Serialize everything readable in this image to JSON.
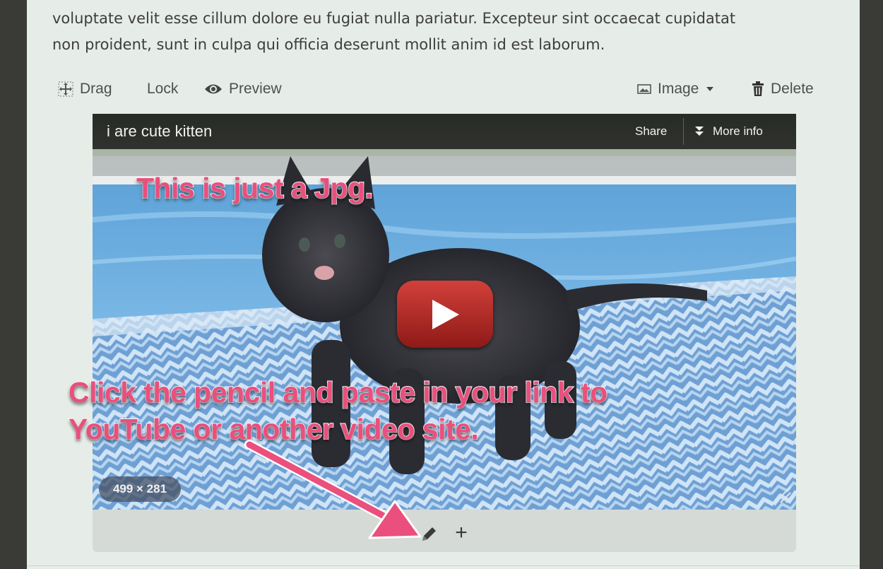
{
  "paragraph": {
    "line1": "voluptate velit esse cillum dolore eu fugiat nulla pariatur. Excepteur sint occaecat cupidatat",
    "line2": "non proident, sunt in culpa qui officia deserunt mollit anim id est laborum."
  },
  "toolbar": {
    "drag_label": "Drag",
    "lock_label": "Lock",
    "preview_label": "Preview",
    "image_label": "Image",
    "delete_label": "Delete",
    "icons": [
      "drag-icon",
      "eye-icon",
      "image-icon",
      "chevron-down-icon",
      "trash-icon"
    ]
  },
  "video": {
    "title": "i are cute kitten",
    "share_label": "Share",
    "more_info_label": "More info",
    "dimensions_badge": "499 × 281"
  },
  "annotations": {
    "caption_top": "This is just a Jpg.",
    "caption_bottom_line1": "Click the pencil and paste in your link to",
    "caption_bottom_line2": "YouTube or another video site."
  },
  "editor_controls": {
    "icons": [
      "pencil-icon",
      "plus-icon"
    ],
    "plus_glyph": "+"
  },
  "colors": {
    "background": "#3a3a37",
    "panel": "#e6ede8",
    "annotation": "#ea4f7d",
    "play_button": "#c0322c"
  }
}
